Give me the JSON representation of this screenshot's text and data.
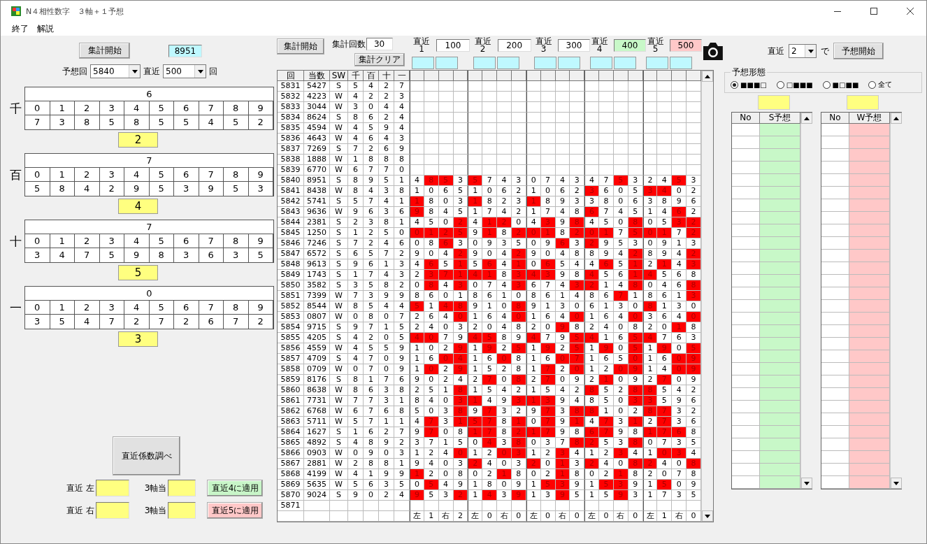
{
  "window": {
    "title": "N４相性数字　３軸＋１予想"
  },
  "menu": [
    "終了",
    "解説"
  ],
  "left": {
    "start_button": "集計開始",
    "result": "8951",
    "round_label": "予想回",
    "round": "5840",
    "recent_label": "直近",
    "recent": "500",
    "recent_unit": "回",
    "positions": [
      {
        "label": "千",
        "header": "6",
        "digits": [
          "0",
          "1",
          "2",
          "3",
          "4",
          "5",
          "6",
          "7",
          "8",
          "9"
        ],
        "values": [
          "7",
          "3",
          "8",
          "5",
          "8",
          "5",
          "5",
          "4",
          "5",
          "2"
        ],
        "pick": "2"
      },
      {
        "label": "百",
        "header": "7",
        "digits": [
          "0",
          "1",
          "2",
          "3",
          "4",
          "5",
          "6",
          "7",
          "8",
          "9"
        ],
        "values": [
          "5",
          "8",
          "4",
          "2",
          "9",
          "5",
          "3",
          "9",
          "5",
          "3"
        ],
        "pick": "4"
      },
      {
        "label": "十",
        "header": "7",
        "digits": [
          "0",
          "1",
          "2",
          "3",
          "4",
          "5",
          "6",
          "7",
          "8",
          "9"
        ],
        "values": [
          "3",
          "4",
          "7",
          "5",
          "9",
          "8",
          "3",
          "6",
          "3",
          "5"
        ],
        "pick": "5"
      },
      {
        "label": "一",
        "header": "0",
        "digits": [
          "0",
          "1",
          "2",
          "3",
          "4",
          "5",
          "6",
          "7",
          "8",
          "9"
        ],
        "values": [
          "3",
          "5",
          "4",
          "7",
          "2",
          "7",
          "2",
          "6",
          "7",
          "2"
        ],
        "pick": "3"
      }
    ],
    "coef_button": "直近係数調べ",
    "adjust": [
      {
        "label": "直近 左",
        "axis_label": "3軸当",
        "button": "直近4に適用",
        "color": "#c8f5c8"
      },
      {
        "label": "直近 右",
        "axis_label": "3軸当",
        "button": "直近5に適用",
        "color": "#ffc8c8"
      }
    ]
  },
  "toolbar": {
    "start_button": "集計開始",
    "count_label": "集計回数",
    "count": "30",
    "clear_button": "集計クリア",
    "recents": [
      {
        "label": "直近",
        "index": "1",
        "value": "100",
        "color": "#ffffff"
      },
      {
        "label": "直近",
        "index": "2",
        "value": "200",
        "color": "#ffffff"
      },
      {
        "label": "直近",
        "index": "3",
        "value": "300",
        "color": "#ffffff"
      },
      {
        "label": "直近",
        "index": "4",
        "value": "400",
        "color": "#c8f8c8"
      },
      {
        "label": "直近",
        "index": "5",
        "value": "500",
        "color": "#ffc8c8"
      }
    ]
  },
  "grid": {
    "columns": [
      "回",
      "当数",
      "SW",
      "千",
      "百",
      "十",
      "一"
    ],
    "rows": [
      {
        "round": "5831",
        "number": "5427",
        "sw": "S",
        "digits": [
          "5",
          "4",
          "2",
          "7"
        ]
      },
      {
        "round": "5832",
        "number": "4223",
        "sw": "W",
        "digits": [
          "4",
          "2",
          "2",
          "3"
        ]
      },
      {
        "round": "5833",
        "number": "3044",
        "sw": "W",
        "digits": [
          "3",
          "0",
          "4",
          "4"
        ]
      },
      {
        "round": "5834",
        "number": "8624",
        "sw": "S",
        "digits": [
          "8",
          "6",
          "2",
          "4"
        ]
      },
      {
        "round": "5835",
        "number": "4594",
        "sw": "W",
        "digits": [
          "4",
          "5",
          "9",
          "4"
        ]
      },
      {
        "round": "5836",
        "number": "4643",
        "sw": "W",
        "digits": [
          "4",
          "6",
          "4",
          "3"
        ]
      },
      {
        "round": "5837",
        "number": "7269",
        "sw": "S",
        "digits": [
          "7",
          "2",
          "6",
          "9"
        ]
      },
      {
        "round": "5838",
        "number": "1888",
        "sw": "W",
        "digits": [
          "1",
          "8",
          "8",
          "8"
        ]
      },
      {
        "round": "5839",
        "number": "6770",
        "sw": "W",
        "digits": [
          "6",
          "7",
          "7",
          "0"
        ]
      },
      {
        "round": "5840",
        "number": "8951",
        "sw": "S",
        "digits": [
          "8",
          "9",
          "5",
          "1"
        ],
        "cells": [
          "4",
          "8",
          "5",
          "3",
          "5",
          "7",
          "4",
          "3",
          "0",
          "7",
          "4",
          "3",
          "4",
          "7",
          "5",
          "3",
          "2",
          "4",
          "5",
          "3"
        ],
        "marked": [
          false,
          true,
          true,
          false,
          true,
          false,
          false,
          false,
          false,
          false,
          false,
          false,
          false,
          false,
          true,
          false,
          false,
          false,
          true,
          false
        ]
      },
      {
        "round": "5841",
        "number": "8438",
        "sw": "W",
        "digits": [
          "8",
          "4",
          "3",
          "8"
        ],
        "cells": [
          "1",
          "0",
          "6",
          "5",
          "1",
          "0",
          "6",
          "2",
          "1",
          "0",
          "6",
          "2",
          "3",
          "6",
          "0",
          "5",
          "3",
          "4",
          "0",
          "2"
        ],
        "marked": [
          false,
          false,
          false,
          false,
          false,
          false,
          false,
          false,
          false,
          false,
          false,
          false,
          true,
          false,
          false,
          false,
          true,
          true,
          false,
          false
        ]
      },
      {
        "round": "5842",
        "number": "5741",
        "sw": "S",
        "digits": [
          "5",
          "7",
          "4",
          "1"
        ],
        "cells": [
          "1",
          "8",
          "0",
          "3",
          "1",
          "8",
          "2",
          "3",
          "1",
          "8",
          "9",
          "3",
          "3",
          "8",
          "0",
          "6",
          "3",
          "8",
          "9",
          "6"
        ],
        "marked": [
          true,
          false,
          false,
          false,
          true,
          false,
          false,
          false,
          true,
          false,
          false,
          false,
          false,
          false,
          false,
          false,
          false,
          false,
          false,
          false
        ]
      },
      {
        "round": "5843",
        "number": "9636",
        "sw": "W",
        "digits": [
          "9",
          "6",
          "3",
          "6"
        ],
        "cells": [
          "9",
          "8",
          "4",
          "5",
          "1",
          "7",
          "4",
          "2",
          "1",
          "7",
          "4",
          "8",
          "6",
          "7",
          "4",
          "5",
          "1",
          "4",
          "6",
          "2"
        ],
        "marked": [
          true,
          false,
          false,
          false,
          false,
          false,
          false,
          false,
          false,
          false,
          false,
          false,
          true,
          false,
          false,
          false,
          false,
          false,
          true,
          false
        ]
      },
      {
        "round": "5844",
        "number": "2381",
        "sw": "S",
        "digits": [
          "2",
          "3",
          "8",
          "1"
        ],
        "cells": [
          "4",
          "5",
          "0",
          "2",
          "4",
          "1",
          "2",
          "0",
          "4",
          "3",
          "9",
          "8",
          "4",
          "5",
          "0",
          "8",
          "0",
          "5",
          "3",
          "2"
        ],
        "marked": [
          false,
          false,
          false,
          true,
          false,
          true,
          true,
          false,
          false,
          true,
          false,
          true,
          false,
          false,
          false,
          true,
          false,
          false,
          true,
          true
        ]
      },
      {
        "round": "5845",
        "number": "1250",
        "sw": "S",
        "digits": [
          "1",
          "2",
          "5",
          "0"
        ],
        "cells": [
          "0",
          "1",
          "2",
          "5",
          "9",
          "1",
          "8",
          "2",
          "0",
          "1",
          "8",
          "2",
          "0",
          "1",
          "7",
          "5",
          "0",
          "1",
          "7",
          "2"
        ],
        "marked": [
          true,
          true,
          true,
          true,
          false,
          true,
          false,
          true,
          true,
          true,
          false,
          true,
          true,
          true,
          false,
          true,
          true,
          true,
          false,
          true
        ]
      },
      {
        "round": "5846",
        "number": "7246",
        "sw": "S",
        "digits": [
          "7",
          "2",
          "4",
          "6"
        ],
        "cells": [
          "0",
          "8",
          "6",
          "3",
          "0",
          "9",
          "3",
          "5",
          "0",
          "9",
          "6",
          "3",
          "2",
          "9",
          "5",
          "3",
          "0",
          "9",
          "1",
          "3"
        ],
        "marked": [
          false,
          false,
          true,
          false,
          false,
          false,
          false,
          false,
          false,
          false,
          true,
          false,
          true,
          false,
          false,
          false,
          false,
          false,
          false,
          false
        ]
      },
      {
        "round": "5847",
        "number": "6572",
        "sw": "S",
        "digits": [
          "6",
          "5",
          "7",
          "2"
        ],
        "cells": [
          "9",
          "0",
          "4",
          "2",
          "9",
          "0",
          "4",
          "2",
          "9",
          "0",
          "4",
          "8",
          "8",
          "9",
          "4",
          "2",
          "8",
          "9",
          "4",
          "2"
        ],
        "marked": [
          false,
          false,
          false,
          true,
          false,
          false,
          false,
          true,
          false,
          false,
          false,
          false,
          false,
          false,
          false,
          true,
          false,
          false,
          false,
          true
        ]
      },
      {
        "round": "5848",
        "number": "9613",
        "sw": "S",
        "digits": [
          "9",
          "6",
          "1",
          "3"
        ],
        "cells": [
          "4",
          "6",
          "5",
          "1",
          "5",
          "6",
          "4",
          "1",
          "0",
          "6",
          "5",
          "4",
          "4",
          "6",
          "5",
          "1",
          "2",
          "1",
          "4",
          "3"
        ],
        "marked": [
          false,
          true,
          false,
          true,
          false,
          true,
          false,
          true,
          false,
          true,
          false,
          false,
          false,
          true,
          false,
          true,
          false,
          true,
          false,
          true
        ]
      },
      {
        "round": "5849",
        "number": "1743",
        "sw": "S",
        "digits": [
          "1",
          "7",
          "4",
          "3"
        ],
        "cells": [
          "2",
          "3",
          "7",
          "1",
          "4",
          "1",
          "8",
          "3",
          "4",
          "3",
          "9",
          "8",
          "4",
          "5",
          "6",
          "1",
          "4",
          "5",
          "6",
          "8"
        ],
        "marked": [
          false,
          true,
          true,
          true,
          true,
          true,
          false,
          true,
          true,
          true,
          false,
          false,
          true,
          false,
          false,
          true,
          true,
          false,
          false,
          false
        ]
      },
      {
        "round": "5850",
        "number": "3582",
        "sw": "S",
        "digits": [
          "3",
          "5",
          "8",
          "2"
        ],
        "cells": [
          "0",
          "8",
          "4",
          "3",
          "0",
          "7",
          "4",
          "3",
          "6",
          "7",
          "4",
          "3",
          "2",
          "1",
          "4",
          "8",
          "0",
          "4",
          "6",
          "8"
        ],
        "marked": [
          false,
          true,
          false,
          true,
          false,
          false,
          false,
          true,
          false,
          false,
          false,
          true,
          true,
          false,
          false,
          true,
          false,
          false,
          false,
          true
        ]
      },
      {
        "round": "5851",
        "number": "7399",
        "sw": "W",
        "digits": [
          "7",
          "3",
          "9",
          "9"
        ],
        "cells": [
          "8",
          "6",
          "0",
          "1",
          "8",
          "6",
          "1",
          "0",
          "8",
          "6",
          "1",
          "4",
          "8",
          "6",
          "7",
          "1",
          "8",
          "6",
          "1",
          "3"
        ],
        "marked": [
          false,
          false,
          false,
          false,
          false,
          false,
          false,
          false,
          false,
          false,
          false,
          false,
          false,
          false,
          true,
          false,
          false,
          false,
          false,
          true
        ]
      },
      {
        "round": "5852",
        "number": "8544",
        "sw": "W",
        "digits": [
          "8",
          "5",
          "4",
          "4"
        ],
        "cells": [
          "5",
          "1",
          "4",
          "8",
          "9",
          "1",
          "0",
          "8",
          "9",
          "1",
          "3",
          "0",
          "6",
          "1",
          "3",
          "0",
          "8",
          "1",
          "3",
          "0"
        ],
        "marked": [
          true,
          false,
          true,
          true,
          false,
          false,
          false,
          true,
          false,
          false,
          false,
          false,
          false,
          false,
          false,
          false,
          true,
          false,
          false,
          false
        ]
      },
      {
        "round": "5853",
        "number": "0807",
        "sw": "W",
        "digits": [
          "0",
          "8",
          "0",
          "7"
        ],
        "cells": [
          "2",
          "6",
          "4",
          "0",
          "1",
          "6",
          "4",
          "0",
          "1",
          "6",
          "4",
          "0",
          "1",
          "6",
          "4",
          "0",
          "3",
          "6",
          "4",
          "0"
        ],
        "marked": [
          false,
          false,
          false,
          true,
          false,
          false,
          false,
          true,
          false,
          false,
          false,
          true,
          false,
          false,
          false,
          true,
          false,
          false,
          false,
          true
        ]
      },
      {
        "round": "5854",
        "number": "9715",
        "sw": "S",
        "digits": [
          "9",
          "7",
          "1",
          "5"
        ],
        "cells": [
          "2",
          "4",
          "0",
          "3",
          "2",
          "0",
          "4",
          "8",
          "2",
          "0",
          "9",
          "8",
          "2",
          "4",
          "0",
          "8",
          "2",
          "0",
          "1",
          "8"
        ],
        "marked": [
          false,
          false,
          false,
          false,
          false,
          false,
          false,
          false,
          false,
          false,
          true,
          false,
          false,
          false,
          false,
          false,
          false,
          false,
          true,
          false
        ]
      },
      {
        "round": "5855",
        "number": "4205",
        "sw": "S",
        "digits": [
          "4",
          "2",
          "0",
          "5"
        ],
        "cells": [
          "4",
          "0",
          "7",
          "9",
          "4",
          "5",
          "8",
          "9",
          "4",
          "7",
          "9",
          "5",
          "4",
          "1",
          "6",
          "5",
          "4",
          "7",
          "6",
          "3"
        ],
        "marked": [
          true,
          true,
          false,
          false,
          true,
          true,
          false,
          false,
          true,
          false,
          false,
          true,
          true,
          false,
          false,
          true,
          true,
          false,
          false,
          false
        ]
      },
      {
        "round": "5856",
        "number": "4559",
        "sw": "W",
        "digits": [
          "4",
          "5",
          "5",
          "9"
        ],
        "cells": [
          "1",
          "0",
          "2",
          "9",
          "1",
          "9",
          "2",
          "5",
          "1",
          "9",
          "2",
          "5",
          "1",
          "9",
          "0",
          "5",
          "1",
          "9",
          "0",
          "5"
        ],
        "marked": [
          false,
          false,
          false,
          true,
          false,
          true,
          false,
          true,
          false,
          true,
          false,
          true,
          false,
          true,
          false,
          true,
          false,
          true,
          false,
          true
        ]
      },
      {
        "round": "5857",
        "number": "4709",
        "sw": "S",
        "digits": [
          "4",
          "7",
          "0",
          "9"
        ],
        "cells": [
          "1",
          "6",
          "0",
          "4",
          "1",
          "6",
          "0",
          "8",
          "1",
          "6",
          "0",
          "7",
          "1",
          "6",
          "5",
          "0",
          "1",
          "6",
          "0",
          "9"
        ],
        "marked": [
          false,
          false,
          true,
          true,
          false,
          false,
          true,
          false,
          false,
          false,
          true,
          true,
          false,
          false,
          false,
          true,
          false,
          false,
          true,
          true
        ]
      },
      {
        "round": "5858",
        "number": "0709",
        "sw": "W",
        "digits": [
          "0",
          "7",
          "0",
          "9"
        ],
        "cells": [
          "1",
          "0",
          "2",
          "9",
          "1",
          "5",
          "2",
          "8",
          "1",
          "7",
          "2",
          "0",
          "1",
          "2",
          "0",
          "9",
          "1",
          "4",
          "0",
          "9"
        ],
        "marked": [
          false,
          true,
          false,
          true,
          false,
          false,
          false,
          false,
          false,
          true,
          false,
          true,
          false,
          false,
          true,
          true,
          false,
          false,
          true,
          true
        ]
      },
      {
        "round": "5859",
        "number": "8176",
        "sw": "S",
        "digits": [
          "8",
          "1",
          "7",
          "6"
        ],
        "cells": [
          "9",
          "0",
          "2",
          "4",
          "2",
          "7",
          "0",
          "8",
          "2",
          "7",
          "0",
          "9",
          "2",
          "1",
          "0",
          "9",
          "2",
          "7",
          "0",
          "9"
        ],
        "marked": [
          false,
          false,
          false,
          false,
          false,
          true,
          false,
          true,
          false,
          true,
          false,
          false,
          false,
          true,
          false,
          false,
          false,
          true,
          false,
          false
        ]
      },
      {
        "round": "5860",
        "number": "8638",
        "sw": "W",
        "digits": [
          "8",
          "6",
          "3",
          "8"
        ],
        "cells": [
          "2",
          "5",
          "1",
          "8",
          "1",
          "5",
          "4",
          "2",
          "1",
          "5",
          "4",
          "2",
          "8",
          "5",
          "2",
          "8",
          "8",
          "5",
          "4",
          "2"
        ],
        "marked": [
          false,
          false,
          false,
          true,
          false,
          false,
          false,
          false,
          false,
          false,
          false,
          false,
          true,
          false,
          false,
          true,
          true,
          false,
          false,
          false
        ]
      },
      {
        "round": "5861",
        "number": "7731",
        "sw": "W",
        "digits": [
          "7",
          "7",
          "3",
          "1"
        ],
        "cells": [
          "8",
          "4",
          "0",
          "3",
          "1",
          "4",
          "9",
          "3",
          "1",
          "3",
          "9",
          "4",
          "8",
          "5",
          "0",
          "3",
          "3",
          "5",
          "9",
          "6"
        ],
        "marked": [
          false,
          false,
          false,
          true,
          true,
          false,
          false,
          true,
          true,
          true,
          false,
          false,
          false,
          false,
          false,
          true,
          true,
          false,
          false,
          false
        ]
      },
      {
        "round": "5862",
        "number": "6768",
        "sw": "W",
        "digits": [
          "6",
          "7",
          "6",
          "8"
        ],
        "cells": [
          "5",
          "0",
          "3",
          "8",
          "9",
          "7",
          "3",
          "2",
          "9",
          "7",
          "3",
          "8",
          "8",
          "1",
          "0",
          "2",
          "8",
          "7",
          "3",
          "2"
        ],
        "marked": [
          false,
          false,
          false,
          true,
          false,
          true,
          false,
          false,
          false,
          true,
          false,
          true,
          true,
          false,
          false,
          false,
          true,
          true,
          false,
          false
        ]
      },
      {
        "round": "5863",
        "number": "5711",
        "sw": "W",
        "digits": [
          "5",
          "7",
          "1",
          "1"
        ],
        "cells": [
          "4",
          "7",
          "3",
          "1",
          "5",
          "7",
          "8",
          "1",
          "0",
          "7",
          "9",
          "1",
          "4",
          "7",
          "3",
          "1",
          "2",
          "7",
          "3",
          "6"
        ],
        "marked": [
          false,
          true,
          false,
          true,
          true,
          true,
          false,
          true,
          false,
          true,
          false,
          true,
          false,
          true,
          false,
          true,
          false,
          true,
          false,
          false
        ]
      },
      {
        "round": "5864",
        "number": "1627",
        "sw": "S",
        "digits": [
          "1",
          "6",
          "2",
          "7"
        ],
        "cells": [
          "9",
          "7",
          "0",
          "8",
          "1",
          "7",
          "8",
          "2",
          "1",
          "7",
          "9",
          "8",
          "6",
          "7",
          "9",
          "8",
          "1",
          "7",
          "6",
          "8"
        ],
        "marked": [
          false,
          true,
          false,
          false,
          true,
          true,
          false,
          true,
          true,
          true,
          false,
          false,
          true,
          true,
          false,
          false,
          true,
          true,
          true,
          false
        ]
      },
      {
        "round": "5865",
        "number": "4892",
        "sw": "S",
        "digits": [
          "4",
          "8",
          "9",
          "2"
        ],
        "cells": [
          "3",
          "7",
          "1",
          "5",
          "0",
          "4",
          "3",
          "8",
          "0",
          "3",
          "7",
          "8",
          "2",
          "5",
          "3",
          "8",
          "0",
          "7",
          "3",
          "5"
        ],
        "marked": [
          false,
          false,
          false,
          false,
          false,
          true,
          false,
          true,
          false,
          false,
          false,
          true,
          true,
          false,
          false,
          true,
          false,
          false,
          false,
          false
        ]
      },
      {
        "round": "5866",
        "number": "0903",
        "sw": "W",
        "digits": [
          "0",
          "9",
          "0",
          "3"
        ],
        "cells": [
          "1",
          "2",
          "4",
          "0",
          "1",
          "2",
          "0",
          "3",
          "1",
          "2",
          "3",
          "4",
          "1",
          "2",
          "3",
          "4",
          "1",
          "0",
          "3",
          "4"
        ],
        "marked": [
          false,
          false,
          false,
          true,
          false,
          false,
          true,
          true,
          false,
          false,
          true,
          false,
          false,
          false,
          true,
          false,
          false,
          true,
          true,
          false
        ]
      },
      {
        "round": "5867",
        "number": "2881",
        "sw": "W",
        "digits": [
          "2",
          "8",
          "8",
          "1"
        ],
        "cells": [
          "9",
          "4",
          "0",
          "3",
          "2",
          "4",
          "0",
          "3",
          "2",
          "0",
          "1",
          "3",
          "2",
          "4",
          "0",
          "8",
          "2",
          "4",
          "0",
          "8"
        ],
        "marked": [
          false,
          false,
          false,
          false,
          true,
          false,
          false,
          false,
          true,
          false,
          true,
          false,
          true,
          false,
          false,
          true,
          true,
          false,
          false,
          true
        ]
      },
      {
        "round": "5868",
        "number": "4199",
        "sw": "W",
        "digits": [
          "4",
          "1",
          "9",
          "9"
        ],
        "cells": [
          "1",
          "2",
          "0",
          "8",
          "0",
          "2",
          "1",
          "8",
          "0",
          "2",
          "1",
          "8",
          "0",
          "2",
          "1",
          "8",
          "2",
          "0",
          "7",
          "8"
        ],
        "marked": [
          true,
          false,
          false,
          false,
          false,
          false,
          true,
          false,
          false,
          false,
          true,
          false,
          false,
          false,
          true,
          false,
          false,
          false,
          false,
          false
        ]
      },
      {
        "round": "5869",
        "number": "5635",
        "sw": "W",
        "digits": [
          "5",
          "6",
          "3",
          "5"
        ],
        "cells": [
          "0",
          "5",
          "4",
          "9",
          "1",
          "8",
          "0",
          "9",
          "1",
          "5",
          "3",
          "9",
          "1",
          "5",
          "3",
          "9",
          "1",
          "5",
          "0",
          "9"
        ],
        "marked": [
          false,
          true,
          false,
          false,
          false,
          false,
          false,
          false,
          false,
          true,
          true,
          false,
          false,
          true,
          true,
          false,
          false,
          true,
          false,
          false
        ]
      },
      {
        "round": "5870",
        "number": "9024",
        "sw": "S",
        "digits": [
          "9",
          "0",
          "2",
          "4"
        ],
        "cells": [
          "9",
          "5",
          "3",
          "2",
          "1",
          "4",
          "3",
          "9",
          "1",
          "3",
          "9",
          "5",
          "1",
          "5",
          "9",
          "3",
          "1",
          "7",
          "3",
          "5"
        ],
        "marked": [
          true,
          false,
          false,
          true,
          false,
          true,
          false,
          true,
          false,
          false,
          true,
          false,
          false,
          false,
          true,
          false,
          false,
          false,
          false,
          false
        ]
      },
      {
        "round": "5871"
      }
    ],
    "footer": [
      "左",
      "1",
      "右",
      "2",
      "左",
      "0",
      "右",
      "0",
      "左",
      "0",
      "右",
      "0",
      "左",
      "0",
      "右",
      "0",
      "左",
      "1",
      "右",
      "0"
    ]
  },
  "forecast": {
    "recent_label": "直近",
    "recent": "2",
    "unit": "で",
    "start_button": "予想開始",
    "mode_title": "予想形態",
    "modes": [
      {
        "label": "■■■□",
        "selected": true
      },
      {
        "label": "□■■■",
        "selected": false
      },
      {
        "label": "■□■■",
        "selected": false
      },
      {
        "label": "全て",
        "selected": false
      }
    ],
    "lists": [
      {
        "columns": [
          "No",
          "S予想"
        ],
        "color": "#c8f8c8"
      },
      {
        "columns": [
          "No",
          "W予想"
        ],
        "color": "#ffc8c8"
      }
    ]
  }
}
